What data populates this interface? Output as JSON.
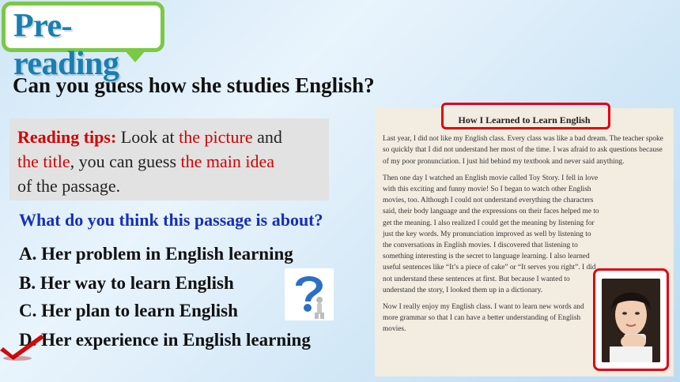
{
  "slide": {
    "title": "Pre-reading",
    "question": "Can you guess how she studies English?",
    "tips": {
      "label": "Reading tips:",
      "t1": " Look at ",
      "picture": "the picture",
      "t2": " and",
      "title_word": "the title",
      "t3": ", you can guess ",
      "main_idea": "the main idea",
      "t4": "of the passage."
    },
    "about_question": "What do you think this passage is about?",
    "options": [
      "A. Her problem in English learning",
      "B. Her way to learn English",
      "C. Her plan to learn English",
      "D. Her experience in English learning"
    ],
    "colors": {
      "accent_green": "#7ac943",
      "title_blue": "#1a7fb0",
      "tip_red": "#d40000",
      "question_blue": "#1530b8",
      "frame_red": "#e3000f"
    }
  },
  "passage": {
    "title": "How I Learned to Learn English",
    "p1": "Last year, I did not like my English class. Every class was like a bad dream. The teacher spoke so quickly that I did not understand her most of the time. I was afraid to ask questions because of my poor pronunciation. I just hid behind my textbook and never said anything.",
    "p2": "Then one day I watched an English movie called Toy Story. I fell in love with this exciting and funny movie! So I began to watch other English movies, too. Although I could not understand everything the characters said, their body language and the expressions on their faces helped me to get the meaning. I also realized I could get the meaning by listening for just the key words. My pronunciation improved as well by listening to the conversations in English movies. I discovered that listening to something interesting is the secret to language learning. I also learned useful sentences like “It’s a piece of cake” or “It serves you right”. I did not understand these sentences at first. But because I wanted to understand the story, I looked them up in a dictionary.",
    "p3": "Now I really enjoy my English class. I want to learn new words and more grammar so that I can have a better understanding of English movies."
  },
  "icons": {
    "question_mark": "question-mark-figure-icon",
    "check": "red-check-icon",
    "photo": "girl-photo"
  }
}
